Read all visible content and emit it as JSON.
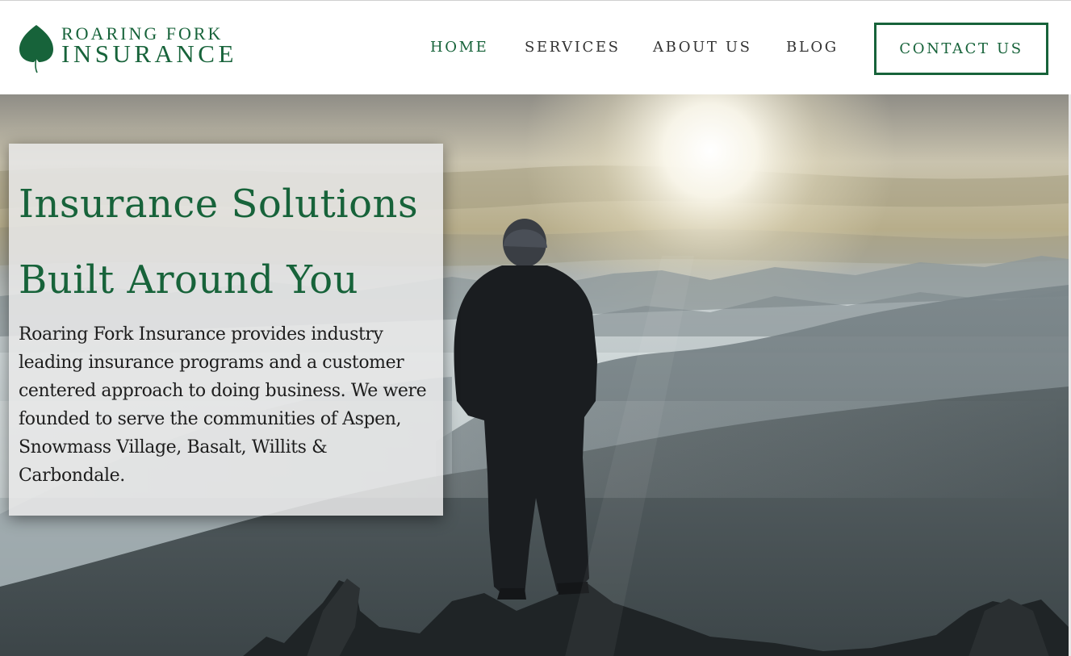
{
  "brand": {
    "line1": "ROARING FORK",
    "line2": "INSURANCE",
    "logo_icon": "aspen-leaf-icon",
    "color": "#17633a"
  },
  "nav": {
    "items": [
      {
        "label": "HOME",
        "active": true
      },
      {
        "label": "SERVICES",
        "active": false
      },
      {
        "label": "ABOUT US",
        "active": false
      },
      {
        "label": "BLOG",
        "active": false
      }
    ],
    "cta_label": "CONTACT US"
  },
  "hero": {
    "headline_line1": "Insurance Solutions",
    "headline_line2": "Built Around You",
    "body": "Roaring Fork Insurance provides industry leading insurance  programs and a customer centered approach to doing business. We were founded to serve the communities of Aspen, Snowmass Village, Basalt, Willits & Carbondale.",
    "image": "man-on-mountain-above-clouds"
  },
  "colors": {
    "accent": "#17633a",
    "text": "#1d1d1d",
    "nav_text": "#333333"
  }
}
